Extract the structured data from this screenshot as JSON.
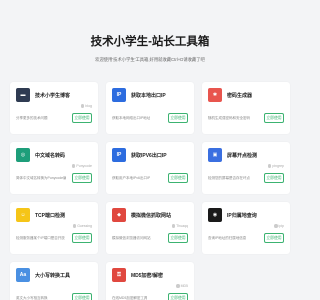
{
  "header": {
    "title": "技术小学生-站长工具箱",
    "subtitle": "欢迎使用'技术小学生'工具箱,好用就收藏Ctrl+D请收藏了吧"
  },
  "button_label": "立即使用",
  "cards": [
    {
      "title": "技术小学生博客",
      "author": "blog",
      "desc": "分享更多的技术问题",
      "icon": "blog-logo-icon",
      "icon_bg": "#2f3b52",
      "icon_glyph": "▬"
    },
    {
      "title": "获取本地出口IP",
      "author": "",
      "desc": "获取本地网络出口IP地址",
      "icon": "ip-icon",
      "icon_bg": "#2d6cdf",
      "icon_glyph": "IP"
    },
    {
      "title": "密码生成器",
      "author": "",
      "desc": "随机生成强密码和安全密码",
      "icon": "password-icon",
      "icon_bg": "#e8554e",
      "icon_glyph": "✱"
    },
    {
      "title": "中文域名转码",
      "author": "Punycode",
      "desc": "简体中文域名转换为Punycode编码",
      "icon": "globe-icon",
      "icon_bg": "#1e9e7a",
      "icon_glyph": "◎"
    },
    {
      "title": "获取IPV6出口IP",
      "author": "",
      "desc": "获取用户本地IPv6出口IP",
      "icon": "ipv6-icon",
      "icon_bg": "#2d6cdf",
      "icon_glyph": "IP"
    },
    {
      "title": "屏幕开点检测",
      "author": "pingrep",
      "desc": "检测您的屏幕是否存在坏点",
      "icon": "screen-icon",
      "icon_bg": "#3b6fe0",
      "icon_glyph": "▣"
    },
    {
      "title": "TCP端口检测",
      "author": "Guessing",
      "desc": "检测服务器某个IP端口是否开放",
      "icon": "tcp-icon",
      "icon_bg": "#f5c518",
      "icon_glyph": "☺"
    },
    {
      "title": "模拟微信抓取网站",
      "author": "Thuaqq",
      "desc": "模拟微信浏览器访问网站",
      "icon": "wechat-icon",
      "icon_bg": "#e0483f",
      "icon_glyph": "◆"
    },
    {
      "title": "IP归属地查询",
      "author": "ipip",
      "desc": "查询IP地址的归属地信息",
      "icon": "location-icon",
      "icon_bg": "#1a1a1a",
      "icon_glyph": "◉"
    },
    {
      "title": "大小写转换工具",
      "author": "",
      "desc": "英文大小写相互转换",
      "icon": "case-convert-icon",
      "icon_bg": "#4a90e2",
      "icon_glyph": "Aa"
    },
    {
      "title": "MD5加密/解密",
      "author": "MD5",
      "desc": "在线MD5加密解密工具",
      "icon": "md5-icon",
      "icon_bg": "#e0483f",
      "icon_glyph": "⚿"
    },
    {
      "title": "",
      "author": "",
      "desc": "",
      "icon": "",
      "icon_bg": "",
      "icon_glyph": ""
    }
  ]
}
